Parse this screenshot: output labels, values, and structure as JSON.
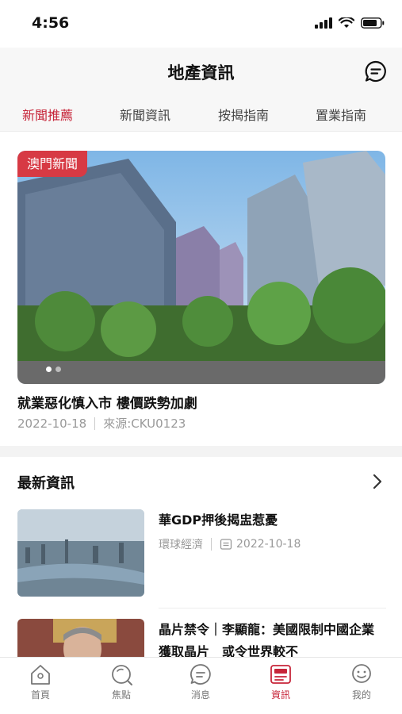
{
  "status": {
    "time": "4:56"
  },
  "header": {
    "title": "地產資訊"
  },
  "tabs": [
    {
      "label": "新聞推薦",
      "active": true
    },
    {
      "label": "新聞資訊",
      "active": false
    },
    {
      "label": "按揭指南",
      "active": false
    },
    {
      "label": "置業指南",
      "active": false
    }
  ],
  "hero": {
    "badge": "澳門新聞",
    "title": "就業惡化慎入市 樓價跌勢加劇",
    "date": "2022-10-18",
    "source": "來源:CKU0123",
    "slide_index": 1,
    "slide_count": 2
  },
  "latest": {
    "heading": "最新資訊",
    "items": [
      {
        "title": "華GDP押後揭盅惹憂",
        "source": "環球經濟",
        "date": "2022-10-18"
      },
      {
        "title": "晶片禁令｜李顯龍：美國限制中國企業獲取晶片　或令世界較不"
      }
    ]
  },
  "tabbar": [
    {
      "label": "首頁",
      "icon": "home-icon"
    },
    {
      "label": "焦點",
      "icon": "focus-icon"
    },
    {
      "label": "消息",
      "icon": "message-icon"
    },
    {
      "label": "資訊",
      "icon": "news-icon",
      "active": true
    },
    {
      "label": "我的",
      "icon": "profile-icon"
    }
  ],
  "colors": {
    "accent": "#c7263a",
    "badge": "#d73a44"
  }
}
